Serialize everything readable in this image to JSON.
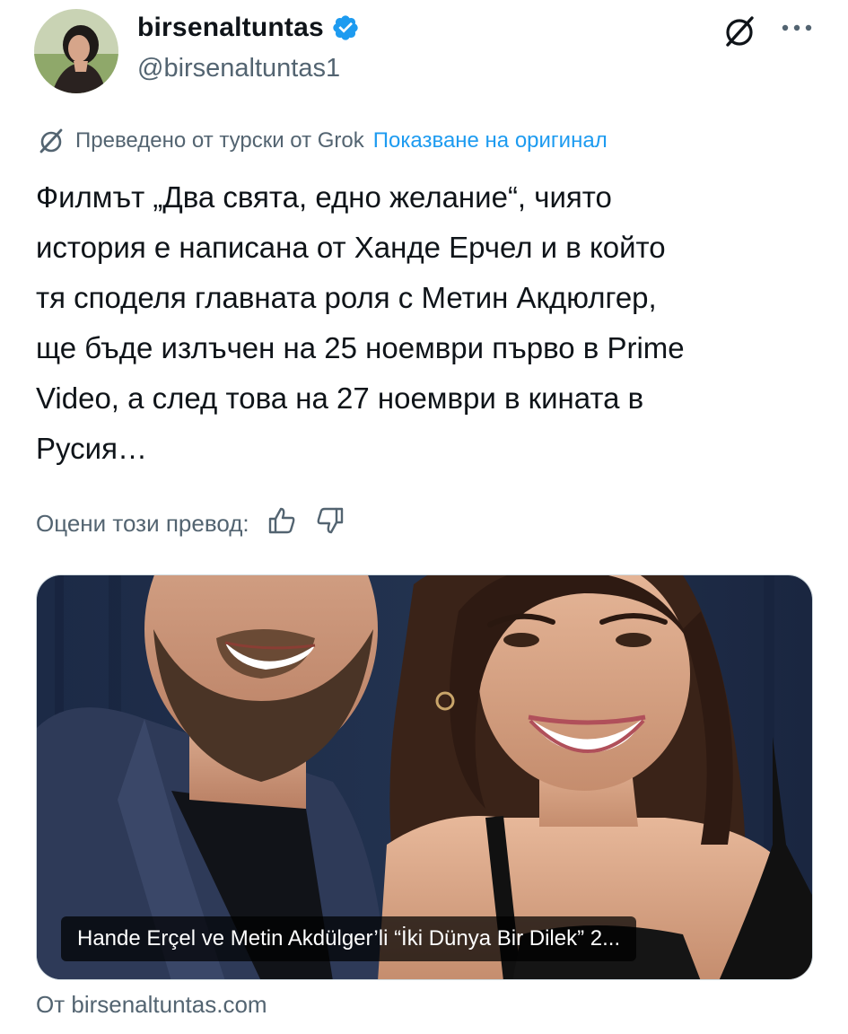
{
  "author": {
    "display_name": "birsenaltuntas",
    "handle": "@birsenaltuntas1",
    "verified": true
  },
  "icons": {
    "verified": "verified-badge-icon",
    "grok": "grok-icon",
    "more": "more-icon",
    "thumbs_up": "thumbs-up-icon",
    "thumbs_down": "thumbs-down-icon"
  },
  "translation": {
    "label": "Преведено от турски от Grok",
    "show_original": "Показване на оригинал"
  },
  "tweet": {
    "lines": [
      "Филмът „Два свята, едно желание“, чиято",
      "история е написана от Ханде Ерчел и в който",
      "тя споделя главната роля с Метин Акдюлгер,",
      "ще бъде излъчен на 25 ноември първо в Prime",
      "Video, а след това на 27 ноември в кината в",
      "Русия…"
    ]
  },
  "rating": {
    "label": "Оцени този превод:"
  },
  "media": {
    "caption": "Hande Erçel ve Metin Akdülger’li “İki Dünya Bir Dilek” 2..."
  },
  "source": {
    "text": "От birsenaltuntas.com"
  },
  "colors": {
    "text": "#0f1419",
    "secondary": "#536471",
    "accent": "#1d9bf0"
  }
}
